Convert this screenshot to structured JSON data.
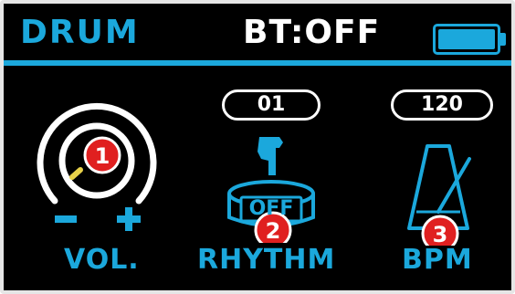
{
  "header": {
    "title": "DRUM",
    "bluetooth_status": "BT:OFF",
    "battery_level": 1.0
  },
  "controls": {
    "volume": {
      "label": "VOL.",
      "minus_symbol": "−",
      "plus_symbol": "+",
      "badge": "1",
      "icon": "knob-icon"
    },
    "rhythm": {
      "label": "RHYTHM",
      "value": "01",
      "drum_state": "OFF",
      "badge": "2",
      "icon": "drum-icon"
    },
    "bpm": {
      "label": "BPM",
      "value": "120",
      "badge": "3",
      "icon": "metronome-icon"
    }
  },
  "colors": {
    "accent": "#1ba8dc",
    "badge": "#e02020",
    "background": "#000000",
    "text": "#ffffff"
  }
}
